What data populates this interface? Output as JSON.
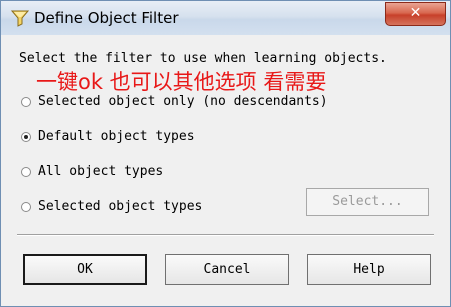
{
  "window": {
    "title": "Define Object Filter",
    "close_glyph": "✕"
  },
  "instruction": "Select the filter to use when learning objects.",
  "overlay_note": "一键ok 也可以其他选项 看需要",
  "options": [
    {
      "label": "Selected object only (no descendants)",
      "checked": false
    },
    {
      "label": "Default object types",
      "checked": true
    },
    {
      "label": "All object types",
      "checked": false
    },
    {
      "label": "Selected object types",
      "checked": false
    }
  ],
  "select_button": {
    "label": "Select...",
    "enabled": false
  },
  "buttons": {
    "ok": "OK",
    "cancel": "Cancel",
    "help": "Help"
  },
  "colors": {
    "overlay_text": "#e81818",
    "close_button": "#c7402a"
  }
}
